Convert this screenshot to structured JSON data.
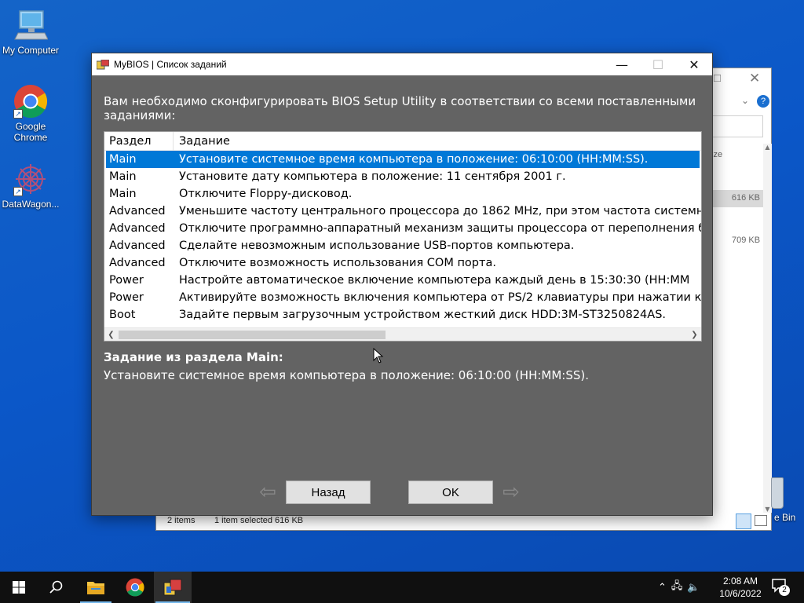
{
  "desktop": {
    "icons": [
      {
        "label": "My Computer",
        "icon": "computer-icon"
      },
      {
        "label": "Google Chrome",
        "icon": "chrome-icon"
      },
      {
        "label": "DataWagon...",
        "icon": "datawagon-icon"
      }
    ],
    "recycle_bin_label": "e Bin"
  },
  "explorer": {
    "column_fragment": "ize",
    "file_sizes": [
      "616 KB",
      "709 KB"
    ],
    "status_items": "2 items",
    "status_selected": "1 item selected  616 KB"
  },
  "dialog": {
    "title": "MyBIOS | Список заданий",
    "instruction": "Вам необходимо сконфигурировать BIOS Setup Utility в соответствии со всеми поставленными заданиями:",
    "columns": {
      "section": "Раздел",
      "task": "Задание"
    },
    "rows": [
      {
        "section": "Main",
        "task": "Установите системное время компьютера в положение: 06:10:00 (HH:MM:SS).",
        "selected": true
      },
      {
        "section": "Main",
        "task": "Установите дату компьютера в положение: 11 сентября 2001 г."
      },
      {
        "section": "Main",
        "task": "Отключите Floppy-дисковод."
      },
      {
        "section": "Advanced",
        "task": "Уменьшите частоту центрального процессора до 1862 MHz, при этом частота системн"
      },
      {
        "section": "Advanced",
        "task": "Отключите программно-аппаратный механизм защиты процессора от переполнения б"
      },
      {
        "section": "Advanced",
        "task": "Сделайте невозможным использование USB-портов компьютера."
      },
      {
        "section": "Advanced",
        "task": "Отключите возможность использования COM порта."
      },
      {
        "section": "Power",
        "task": "Настройте автоматическое включение компьютера каждый день в 15:30:30 (HH:MM"
      },
      {
        "section": "Power",
        "task": "Активируйте возможность включения компьютера от PS/2 клавиатуры при нажатии к"
      },
      {
        "section": "Boot",
        "task": "Задайте первым загрузочным устройством жесткий диск HDD:3M-ST3250824AS."
      }
    ],
    "detail_heading": "Задание из раздела Main:",
    "detail_text": "Установите системное время компьютера в положение: 06:10:00 (HH:MM:SS).",
    "back_label": "Назад",
    "ok_label": "OK"
  },
  "taskbar": {
    "time": "2:08 AM",
    "date": "10/6/2022",
    "notification_count": "2"
  },
  "colors": {
    "desktop": "#0b57c8",
    "dialog_bg": "#636363",
    "selection": "#0078d7",
    "taskbar": "#101010"
  }
}
